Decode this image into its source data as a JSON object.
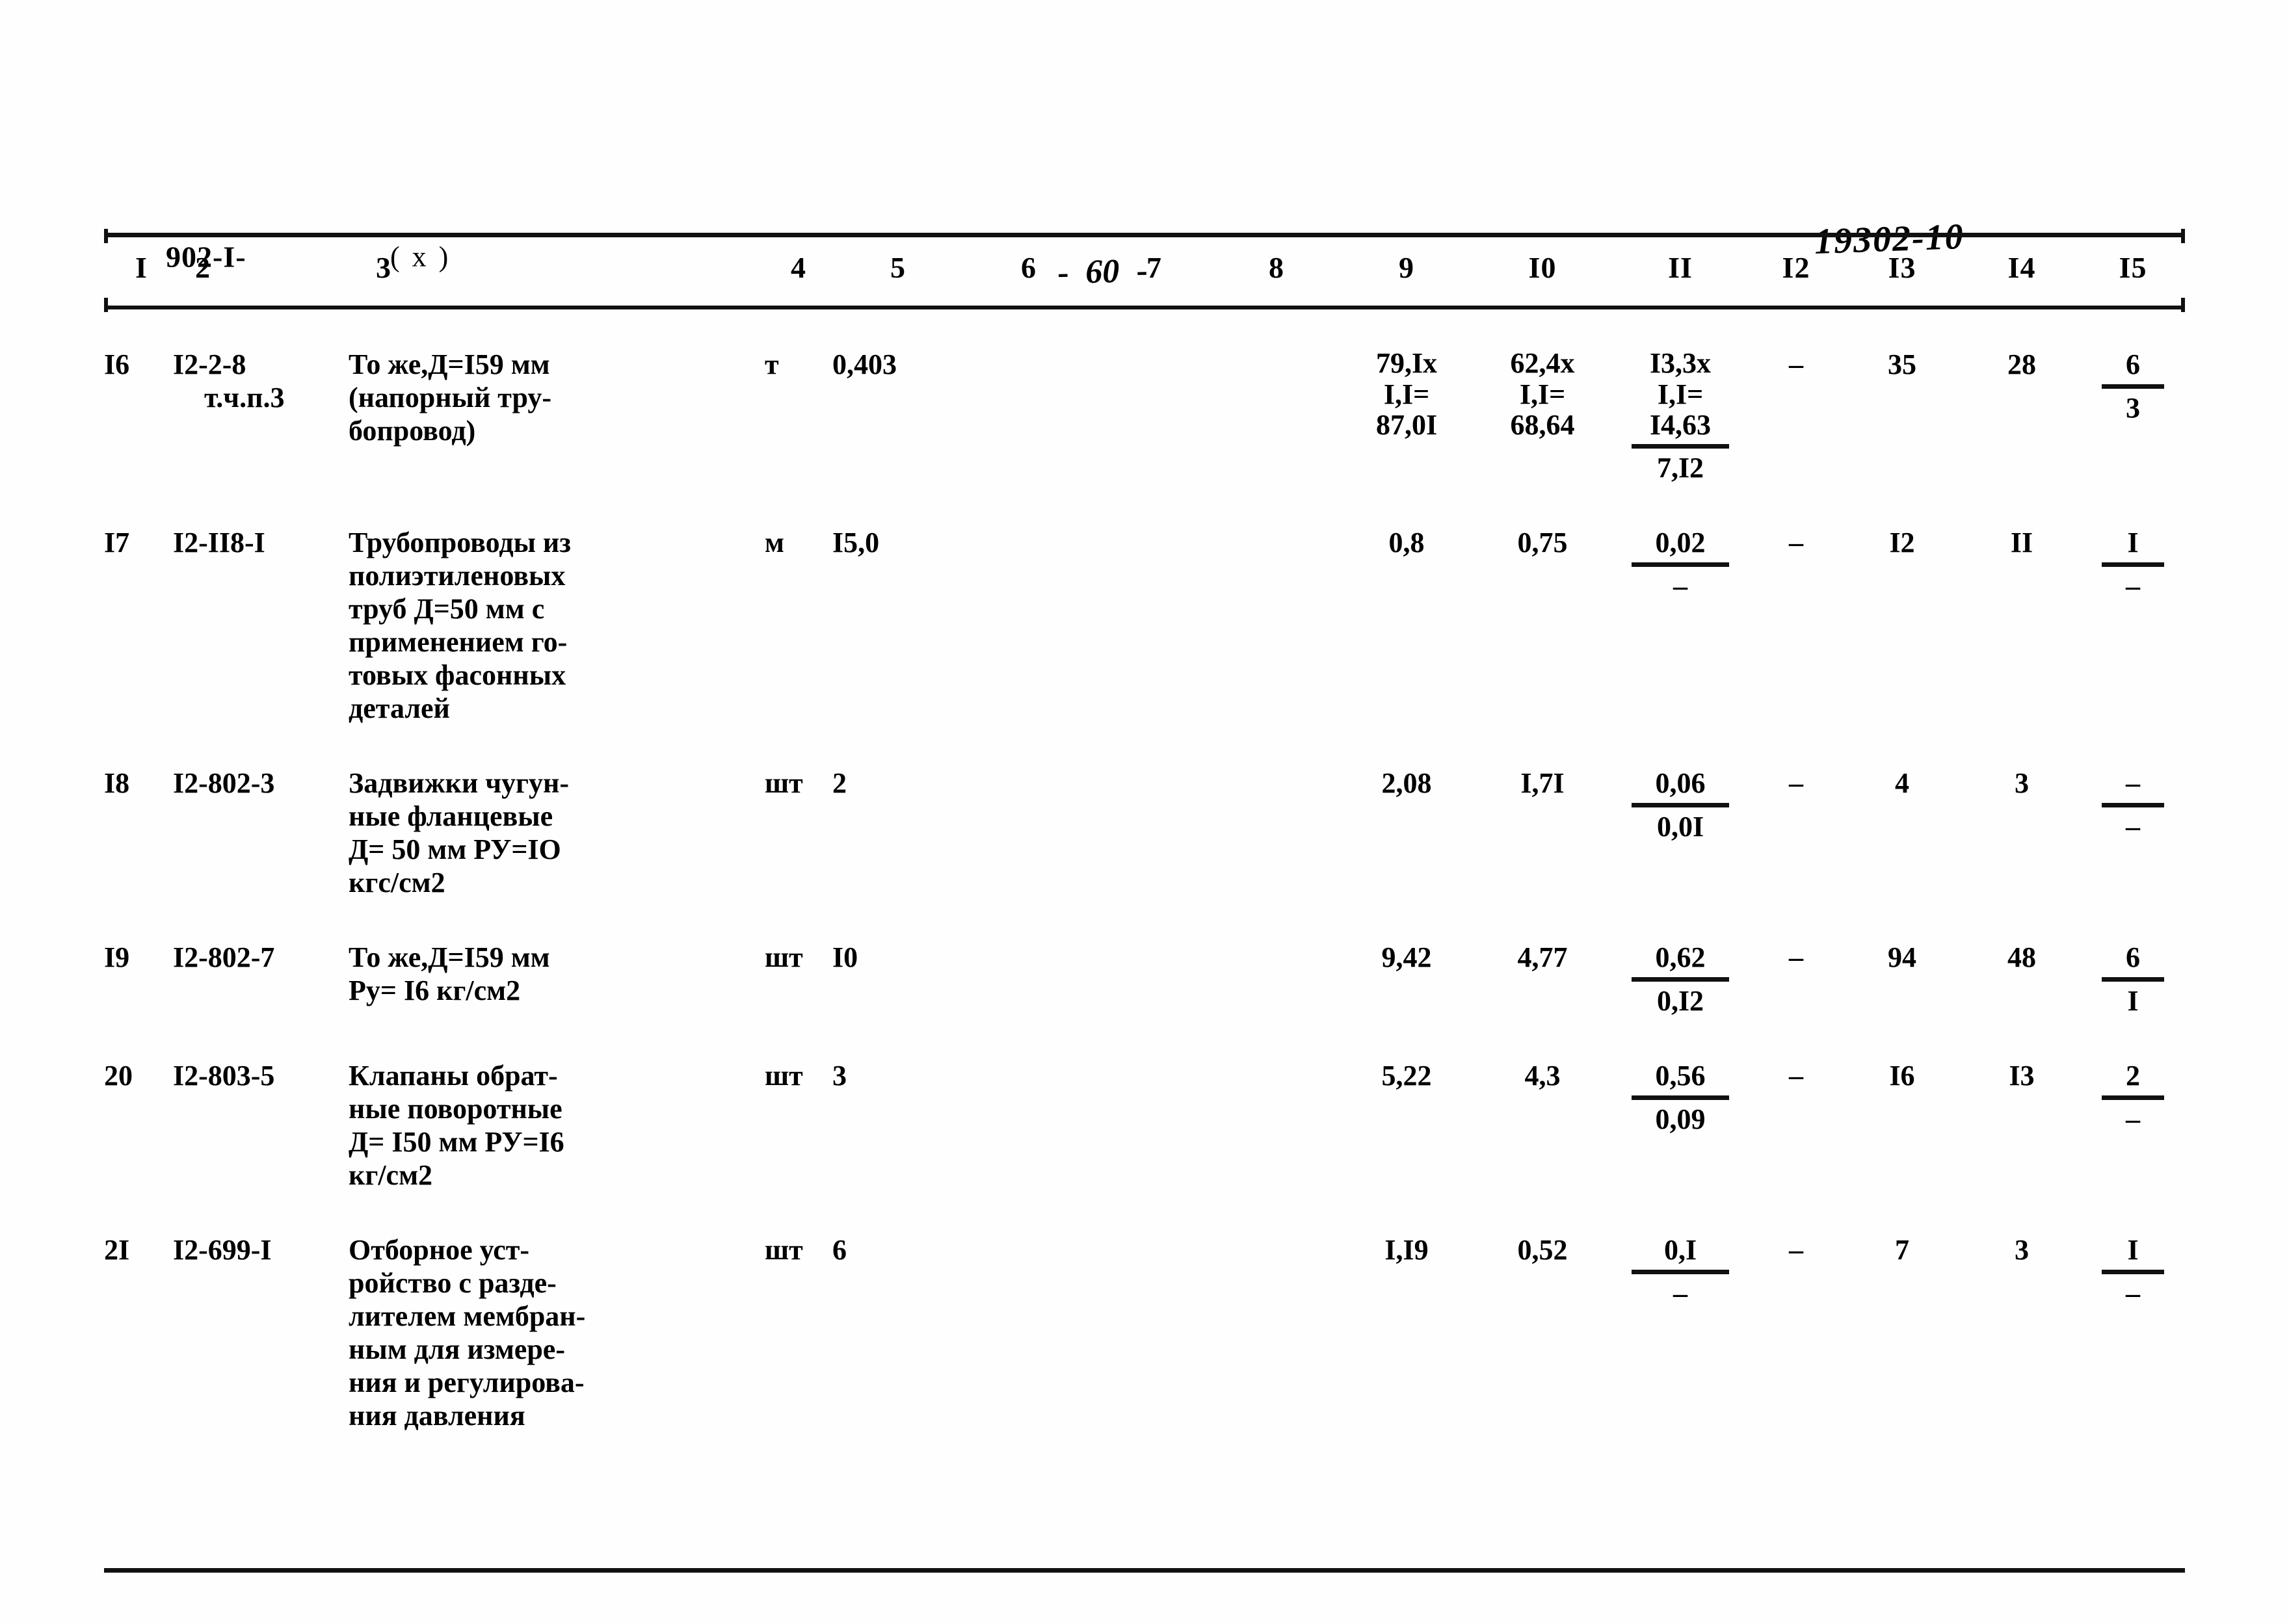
{
  "header": {
    "doc_code": "902-I-",
    "doc_variant": "( x )",
    "page_marker_left_dash": "-",
    "page_marker_number": "60",
    "page_marker_right_dash": "-",
    "archive_stamp": "19302-10"
  },
  "table": {
    "column_headers": [
      "I",
      "2",
      "3",
      "4",
      "5",
      "6",
      "7",
      "8",
      "9",
      "I0",
      "II",
      "I2",
      "I3",
      "I4",
      "I5"
    ],
    "rows": [
      {
        "no": "I6",
        "code_line1": "I2-2-8",
        "code_line2": "т.ч.п.3",
        "desc_lines": [
          "То же,Д=I59 мм",
          "(напорный тру-",
          "бопровод)"
        ],
        "unit": "т",
        "qty": "0,403",
        "c6": "",
        "c7": "",
        "c8": "",
        "c9_stack": [
          "79,Ix",
          "I,I=",
          "87,0I"
        ],
        "c10_stack": [
          "62,4x",
          "I,I=",
          "68,64"
        ],
        "c11_top_stack": [
          "I3,3x",
          "I,I=",
          "I4,63"
        ],
        "c11_bottom": "7,I2",
        "c12": "–",
        "c13": "35",
        "c14": "28",
        "c15_top": "6",
        "c15_bottom": "3"
      },
      {
        "no": "I7",
        "code_line1": "I2-II8-I",
        "code_line2": "",
        "desc_lines": [
          "Трубопроводы из",
          "полиэтиленовых",
          "труб Д=50 мм с",
          "применением го-",
          "товых фасонных",
          "деталей"
        ],
        "unit": "м",
        "qty": "I5,0",
        "c6": "",
        "c7": "",
        "c8": "",
        "c9": "0,8",
        "c10": "0,75",
        "c11_top": "0,02",
        "c11_bottom": "–",
        "c12": "–",
        "c13": "I2",
        "c14": "II",
        "c15_top": "I",
        "c15_bottom": "–"
      },
      {
        "no": "I8",
        "code_line1": "I2-802-3",
        "code_line2": "",
        "desc_lines": [
          "Задвижки чугун-",
          "ные фланцевые",
          "Д= 50 мм РУ=IO",
          "кгс/см2"
        ],
        "unit": "шт",
        "qty": "2",
        "c6": "",
        "c7": "",
        "c8": "",
        "c9": "2,08",
        "c10": "I,7I",
        "c11_top": "0,06",
        "c11_bottom": "0,0I",
        "c12": "–",
        "c13": "4",
        "c14": "3",
        "c15_top": "–",
        "c15_bottom": "–"
      },
      {
        "no": "I9",
        "code_line1": "I2-802-7",
        "code_line2": "",
        "desc_lines": [
          "То же,Д=I59 мм",
          "Ру= I6 кг/см2"
        ],
        "unit": "шт",
        "qty": "I0",
        "c6": "",
        "c7": "",
        "c8": "",
        "c9": "9,42",
        "c10": "4,77",
        "c11_top": "0,62",
        "c11_bottom": "0,I2",
        "c12": "–",
        "c13": "94",
        "c14": "48",
        "c15_top": "6",
        "c15_bottom": "I"
      },
      {
        "no": "20",
        "code_line1": "I2-803-5",
        "code_line2": "",
        "desc_lines": [
          "Клапаны обрат-",
          "ные поворотные",
          "Д= I50 мм РУ=I6",
          "кг/см2"
        ],
        "unit": "шт",
        "qty": "3",
        "c6": "",
        "c7": "",
        "c8": "",
        "c9": "5,22",
        "c10": "4,3",
        "c11_top": "0,56",
        "c11_bottom": "0,09",
        "c12": "–",
        "c13": "I6",
        "c14": "I3",
        "c15_top": "2",
        "c15_bottom": "–"
      },
      {
        "no": "2I",
        "code_line1": "I2-699-I",
        "code_line2": "",
        "desc_lines": [
          "Отборное уст-",
          "ройство с разде-",
          "лителем мембран-",
          "ным для измере-",
          "ния и регулирова-",
          "ния давления"
        ],
        "unit": "шт",
        "qty": "6",
        "c6": "",
        "c7": "",
        "c8": "",
        "c9": "I,I9",
        "c10": "0,52",
        "c11_top": "0,I",
        "c11_bottom": "–",
        "c12": "–",
        "c13": "7",
        "c14": "3",
        "c15_top": "I",
        "c15_bottom": "–"
      }
    ]
  }
}
